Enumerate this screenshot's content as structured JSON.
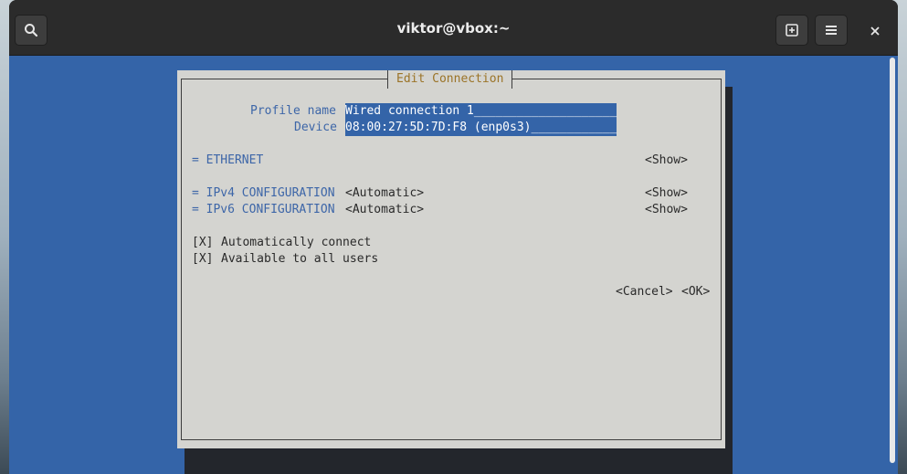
{
  "window": {
    "title": "viktor@vbox:~",
    "search_icon": "search-icon",
    "new_tab_icon": "new-tab-icon",
    "menu_icon": "hamburger-menu-icon",
    "close_icon": "close-icon"
  },
  "dialog": {
    "title": "Edit Connection",
    "profile_name_label": "Profile name",
    "profile_name_value": "Wired connection 1",
    "profile_name_fill": "____________________",
    "device_label": "Device",
    "device_value": "08:00:27:5D:7D:F8 (enp0s3)",
    "device_fill": "____________",
    "ethernet_section": "= ETHERNET",
    "ethernet_show": "<Show>",
    "ipv4_section": "= IPv4 CONFIGURATION",
    "ipv4_mode": "<Automatic>",
    "ipv4_show": "<Show>",
    "ipv6_section": "= IPv6 CONFIGURATION",
    "ipv6_mode": "<Automatic>",
    "ipv6_show": "<Show>",
    "auto_connect_checkbox": "[X]",
    "auto_connect_label": "Automatically connect",
    "all_users_checkbox": "[X]",
    "all_users_label": "Available to all users",
    "cancel_button": "<Cancel>",
    "ok_button": "<OK>"
  },
  "colors": {
    "terminal_bg": "#3464a8",
    "dialog_bg": "#d4d4d0",
    "label_blue": "#3d66a8",
    "title_gold": "#9b7428"
  }
}
